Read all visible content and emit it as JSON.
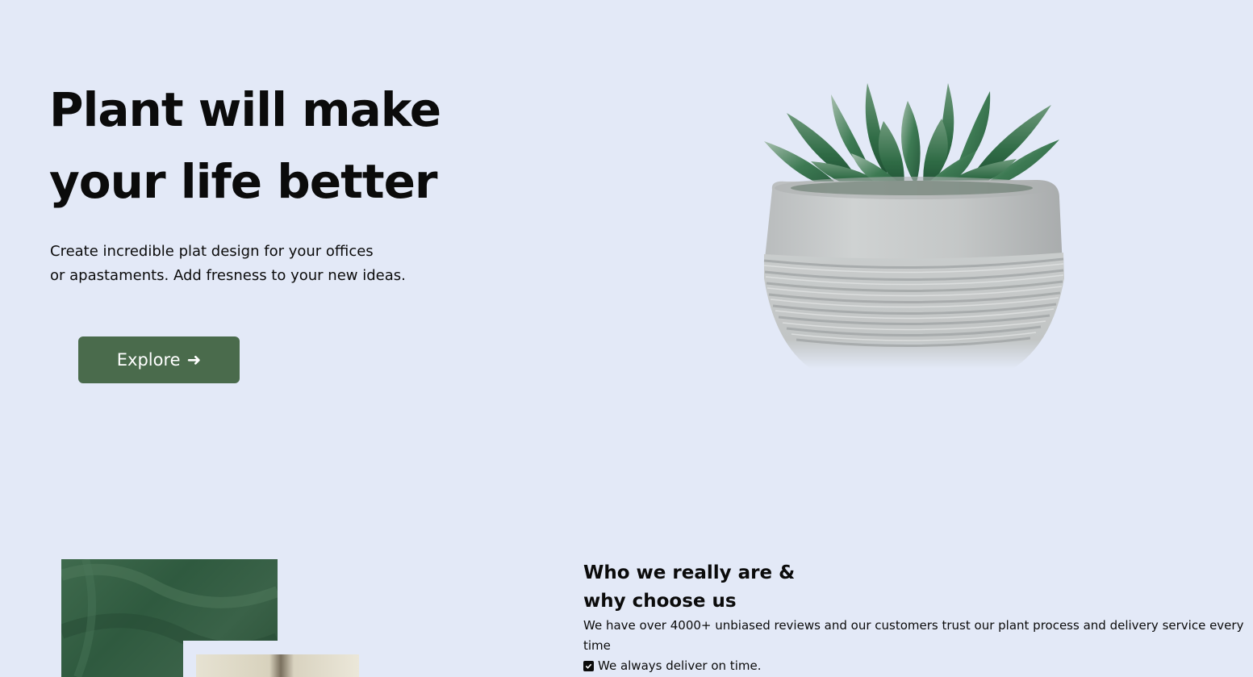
{
  "hero": {
    "title_line1": "Plant will make",
    "title_line2": "your life better",
    "subtitle_line1": "Create incredible plat design for your offices",
    "subtitle_line2": "or apastaments. Add fresness to your new ideas.",
    "explore_label": "Explore",
    "explore_icon": "arrow-right-icon",
    "explore_arrow": "➜",
    "button_color": "#4a6b4c"
  },
  "about": {
    "title_line1": "Who we really are &",
    "title_line2": "why choose us",
    "description": "We have over 4000+ unbiased reviews and our customers trust our plant process and delivery service every time",
    "checklist": [
      {
        "icon": "checkbox-checked-icon",
        "text": "We always deliver on time."
      }
    ]
  },
  "colors": {
    "background": "#e3e9f7",
    "accent": "#4a6b4c",
    "text": "#0b0b0b"
  }
}
